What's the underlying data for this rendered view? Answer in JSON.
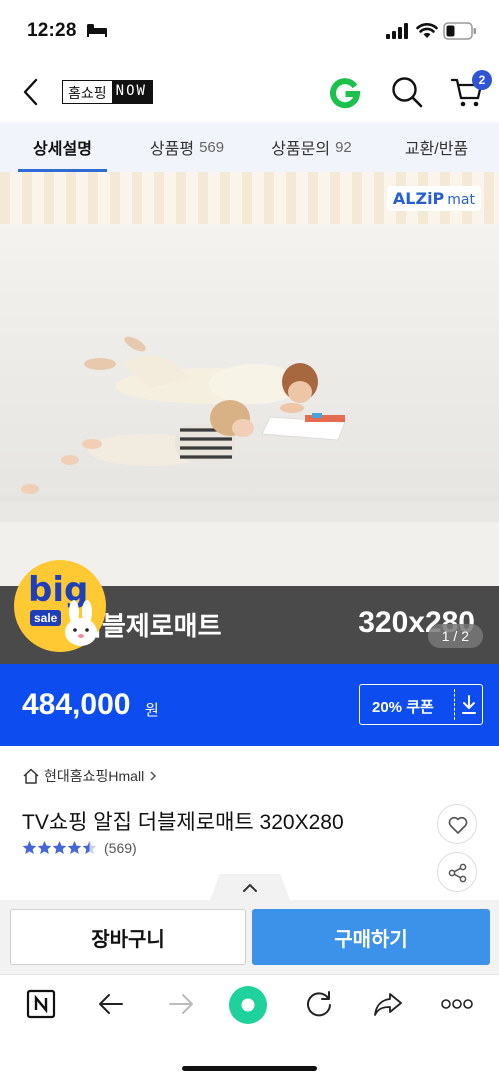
{
  "status_bar": {
    "time": "12:28"
  },
  "header": {
    "logo_left": "홈쇼핑",
    "logo_right": "NOW",
    "cart_count": "2"
  },
  "tabs": [
    {
      "label": "상세설명",
      "count": ""
    },
    {
      "label": "상품평",
      "count": "569"
    },
    {
      "label": "상품문의",
      "count": "92"
    },
    {
      "label": "교환/반품",
      "count": ""
    }
  ],
  "hero": {
    "brand_main": "ALZiP",
    "brand_sub": "mat",
    "caption_left": "더블제로매트",
    "caption_right": "320x280",
    "page_indicator": "1 / 2",
    "badge_big": "big",
    "badge_sale": "sale"
  },
  "price_bar": {
    "price": "484,000",
    "unit": "원",
    "coupon_label": "20% 쿠폰"
  },
  "product": {
    "seller": "현대홈쇼핑Hmall",
    "title": "TV쇼핑 알집 더블제로매트 320X280",
    "rating": 4.5,
    "review_count": "(569)"
  },
  "actions": {
    "cart_label": "장바구니",
    "buy_label": "구매하기"
  },
  "colors": {
    "accent_blue": "#0d4df0",
    "buy_button": "#3c92e8",
    "naver_green": "#03c75a"
  }
}
